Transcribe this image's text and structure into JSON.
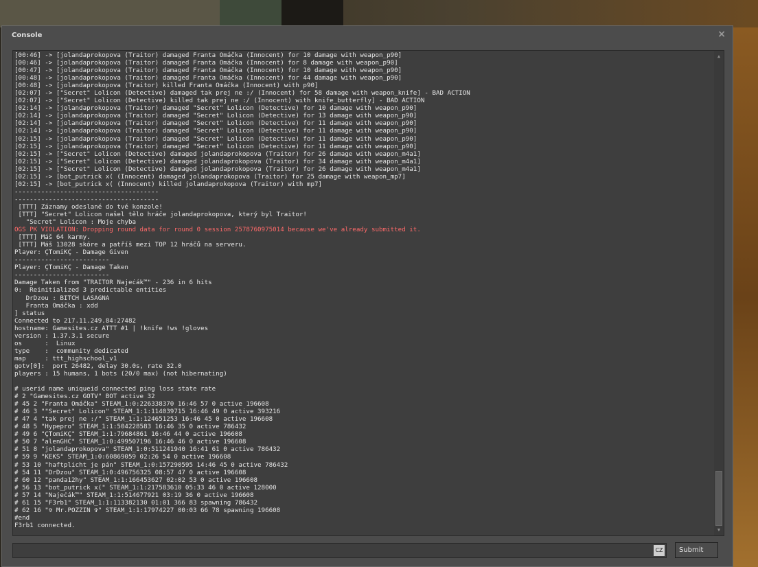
{
  "window": {
    "title": "Console",
    "close_glyph": "×"
  },
  "icons": {
    "close": "close-icon",
    "scroll_up": "arrow-up-icon",
    "scroll_down": "arrow-down-icon"
  },
  "colors": {
    "error_text": "#ff6a6a",
    "text": "#e6e6e6",
    "panel": "#4c4c4c",
    "output_bg": "#3e3e3e"
  },
  "output": {
    "lines": [
      {
        "text": "[00:46] -> [jolandaprokopova (Traitor) damaged Franta Omáčka (Innocent) for 10 damage with weapon_p90]"
      },
      {
        "text": "[00:46] -> [jolandaprokopova (Traitor) damaged Franta Omáčka (Innocent) for 8 damage with weapon_p90]"
      },
      {
        "text": "[00:47] -> [jolandaprokopova (Traitor) damaged Franta Omáčka (Innocent) for 10 damage with weapon_p90]"
      },
      {
        "text": "[00:48] -> [jolandaprokopova (Traitor) damaged Franta Omáčka (Innocent) for 44 damage with weapon_p90]"
      },
      {
        "text": "[00:48] -> [jolandaprokopova (Traitor) killed Franta Omáčka (Innocent) with p90]"
      },
      {
        "text": "[02:07] -> [\"Secret\" Lolicon (Detective) damaged tak prej ne :/ (Innocent) for 58 damage with weapon_knife] - BAD ACTION"
      },
      {
        "text": "[02:07] -> [\"Secret\" Lolicon (Detective) killed tak prej ne :/ (Innocent) with knife_butterfly] - BAD ACTION"
      },
      {
        "text": "[02:14] -> [jolandaprokopova (Traitor) damaged \"Secret\" Lolicon (Detective) for 10 damage with weapon_p90]"
      },
      {
        "text": "[02:14] -> [jolandaprokopova (Traitor) damaged \"Secret\" Lolicon (Detective) for 13 damage with weapon_p90]"
      },
      {
        "text": "[02:14] -> [jolandaprokopova (Traitor) damaged \"Secret\" Lolicon (Detective) for 11 damage with weapon_p90]"
      },
      {
        "text": "[02:14] -> [jolandaprokopova (Traitor) damaged \"Secret\" Lolicon (Detective) for 11 damage with weapon_p90]"
      },
      {
        "text": "[02:15] -> [jolandaprokopova (Traitor) damaged \"Secret\" Lolicon (Detective) for 11 damage with weapon_p90]"
      },
      {
        "text": "[02:15] -> [jolandaprokopova (Traitor) damaged \"Secret\" Lolicon (Detective) for 11 damage with weapon_p90]"
      },
      {
        "text": "[02:15] -> [\"Secret\" Lolicon (Detective) damaged jolandaprokopova (Traitor) for 26 damage with weapon_m4a1]"
      },
      {
        "text": "[02:15] -> [\"Secret\" Lolicon (Detective) damaged jolandaprokopova (Traitor) for 34 damage with weapon_m4a1]"
      },
      {
        "text": "[02:15] -> [\"Secret\" Lolicon (Detective) damaged jolandaprokopova (Traitor) for 26 damage with weapon_m4a1]"
      },
      {
        "text": "[02:15] -> [bot_putrick x( (Innocent) damaged jolandaprokopova (Traitor) for 25 damage with weapon_mp7]"
      },
      {
        "text": "[02:15] -> [bot_putrick x( (Innocent) killed jolandaprokopova (Traitor) with mp7]"
      },
      {
        "text": "--------------------------------------"
      },
      {
        "text": "--------------------------------------"
      },
      {
        "text": " [TTT] Záznamy odeslané do tvé konzole!"
      },
      {
        "text": " [TTT] \"Secret\" Lolicon našel tělo hráče jolandaprokopova, který byl Traitor!"
      },
      {
        "text": "   \"Secret\" Lolicon : Moje chyba"
      },
      {
        "text": "OGS PK VIOLATION: Dropping round data for round 0 session 2578760975014 because we've already submitted it.",
        "error": true
      },
      {
        "text": " [TTT] Máš 64 karmy."
      },
      {
        "text": " [TTT] Máš 13028 skóre a patříš mezi TOP 12 hráčů na serveru."
      },
      {
        "text": "Player: ÇTomiKÇ - Damage Given"
      },
      {
        "text": "-------------------------"
      },
      {
        "text": "Player: ÇTomiKÇ - Damage Taken"
      },
      {
        "text": "-------------------------"
      },
      {
        "text": "Damage Taken from \"TRAITOR Najeċák™\" - 236 in 6 hits"
      },
      {
        "text": "0:  Reinitialized 3 predictable entities"
      },
      {
        "text": "   DrDzou : BITCH LASAGNA"
      },
      {
        "text": "   Franta Omáčka : xdd"
      },
      {
        "text": "] status"
      },
      {
        "text": "Connected to 217.11.249.84:27482"
      },
      {
        "text": "hostname: Gamesites.cz ATTT #1 | !knife !ws !gloves"
      },
      {
        "text": "version : 1.37.3.1 secure"
      },
      {
        "text": "os      :  Linux"
      },
      {
        "text": "type    :  community dedicated"
      },
      {
        "text": "map     : ttt_highschool_v1"
      },
      {
        "text": "gotv[0]:  port 26482, delay 30.0s, rate 32.0"
      },
      {
        "text": "players : 15 humans, 1 bots (20/0 max) (not hibernating)"
      },
      {
        "text": ""
      },
      {
        "text": "# userid name uniqueid connected ping loss state rate"
      },
      {
        "text": "# 2 \"Gamesites.cz GOTV\" BOT active 32"
      },
      {
        "text": "# 45 2 \"Franta Omáčka\" STEAM_1:0:226338370 16:46 57 0 active 196608"
      },
      {
        "text": "# 46 3 \"\"Secret\" Lolicon\" STEAM_1:1:114039715 16:46 49 0 active 393216"
      },
      {
        "text": "# 47 4 \"tak prej ne :/\" STEAM_1:1:124651253 16:46 45 0 active 196608"
      },
      {
        "text": "# 48 5 \"Hypepro\" STEAM_1:1:504228583 16:46 35 0 active 786432"
      },
      {
        "text": "# 49 6 \"ÇTomiKÇ\" STEAM_1:1:79684861 16:46 44 0 active 196608"
      },
      {
        "text": "# 50 7 \"alenGHC\" STEAM_1:0:499507196 16:46 46 0 active 196608"
      },
      {
        "text": "# 51 8 \"jolandaprokopova\" STEAM_1:0:511241940 16:41 61 0 active 786432"
      },
      {
        "text": "# 59 9 \"KEKS\" STEAM_1:0:60869059 02:26 54 0 active 196608"
      },
      {
        "text": "# 53 10 \"haftplicht je pán\" STEAM_1:0:157290595 14:46 45 0 active 786432"
      },
      {
        "text": "# 54 11 \"DrDzou\" STEAM_1:0:496756325 08:57 47 0 active 196608"
      },
      {
        "text": "# 60 12 \"panda12hy\" STEAM_1:1:166453627 02:02 53 0 active 196608"
      },
      {
        "text": "# 56 13 \"bot_putrick x(\" STEAM_1:1:217583610 05:33 46 0 active 128000"
      },
      {
        "text": "# 57 14 \"Najeċák™\" STEAM_1:1:514677921 03:19 36 0 active 196608"
      },
      {
        "text": "# 61 15 \"F3rb1\" STEAM_1:1:113382130 01:01 366 83 spawning 786432"
      },
      {
        "text": "# 62 16 \"✞ Mr.POZZIN ✞\" STEAM_1:1:17974227 00:03 66 78 spawning 196608"
      },
      {
        "text": "#end"
      },
      {
        "text": "F3rb1 connected."
      }
    ]
  },
  "input": {
    "value": "",
    "placeholder": "",
    "lang_badge": "CZ"
  },
  "submit_label": "Submit"
}
